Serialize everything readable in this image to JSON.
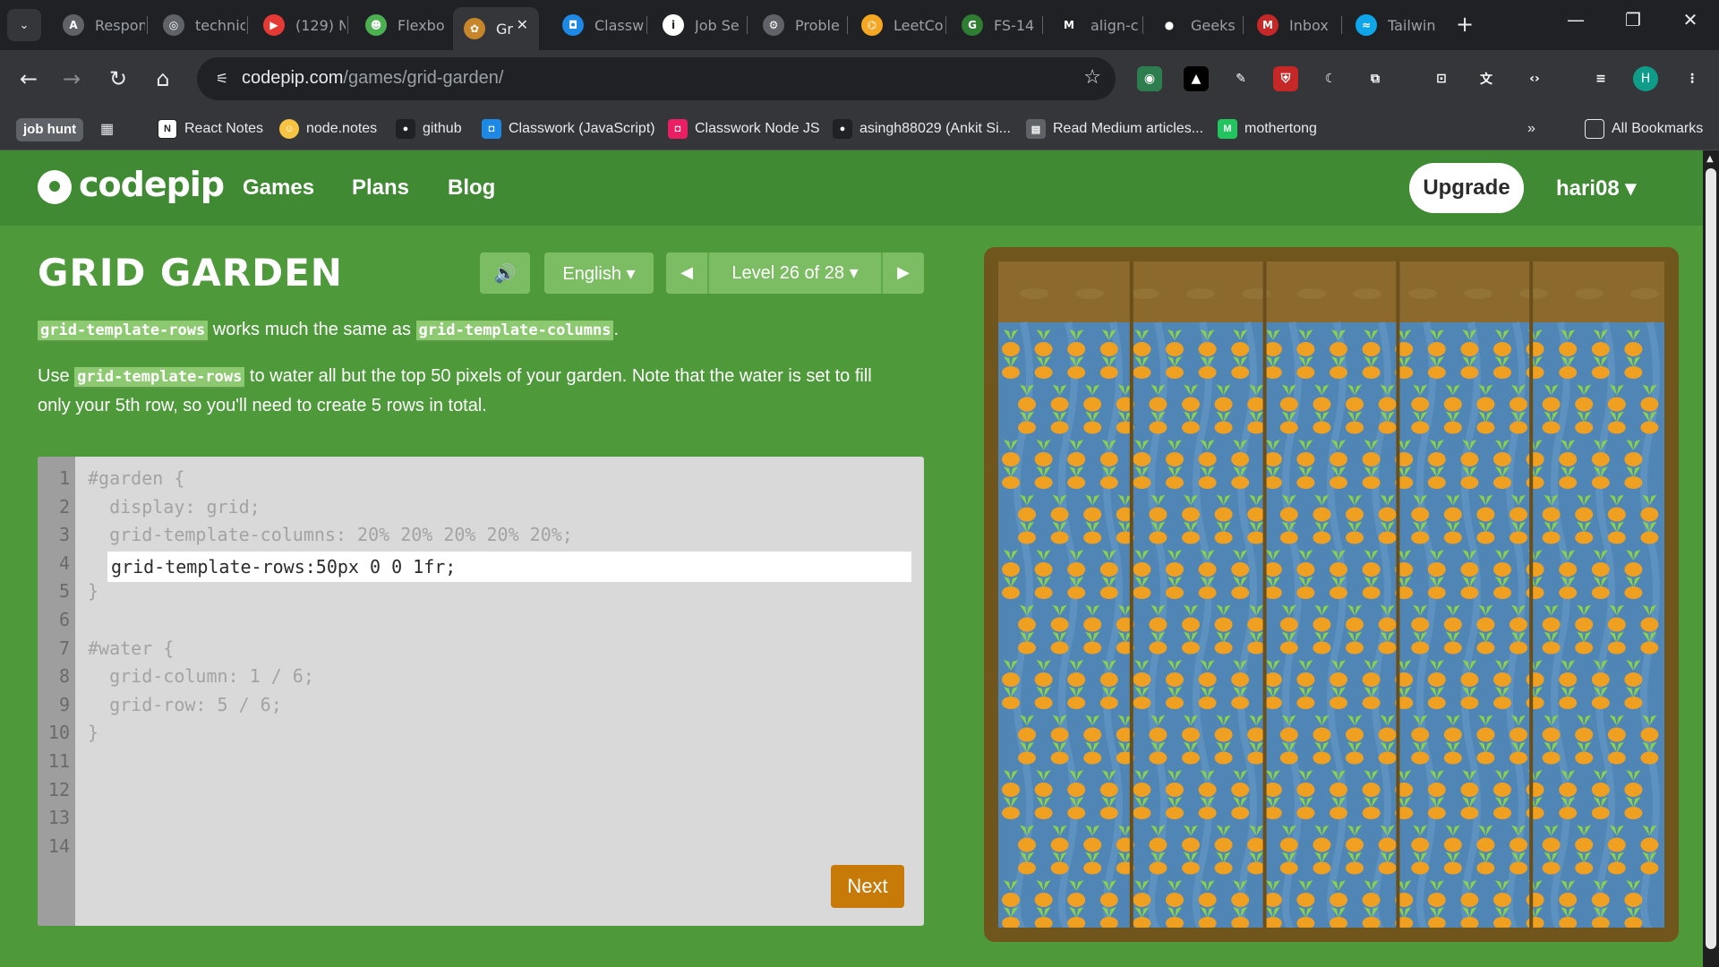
{
  "browser": {
    "tabs": [
      {
        "label": "Respon",
        "icon": "openai-icon",
        "color": "#5f6368",
        "glyph": "A"
      },
      {
        "label": "technic",
        "icon": "globe-icon",
        "color": "#5f6368",
        "glyph": "◎"
      },
      {
        "label": "(129) N",
        "icon": "youtube-icon",
        "color": "#e53935",
        "glyph": "▶"
      },
      {
        "label": "Flexbo",
        "icon": "frog-icon",
        "color": "#4caf50",
        "glyph": "☻"
      },
      {
        "label": "Gr",
        "icon": "carrot-icon",
        "color": "#c8862a",
        "glyph": "✿",
        "active": true
      },
      {
        "label": "Classw",
        "icon": "classroom-icon",
        "color": "#1e88e5",
        "glyph": "◘"
      },
      {
        "label": "Job Se",
        "icon": "info-icon",
        "color": "#ffffff",
        "glyph": "i"
      },
      {
        "label": "Proble",
        "icon": "gear-icon",
        "color": "#5f6368",
        "glyph": "⚙"
      },
      {
        "label": "LeetCo",
        "icon": "leetcode-icon",
        "color": "#f5a623",
        "glyph": "⌬"
      },
      {
        "label": "FS-14",
        "icon": "g-logo-icon",
        "color": "#2e7d32",
        "glyph": "G"
      },
      {
        "label": "align-c",
        "icon": "m-logo-icon",
        "color": "#202124",
        "glyph": "M"
      },
      {
        "label": "Geeks",
        "icon": "github-icon",
        "color": "#202124",
        "glyph": "●"
      },
      {
        "label": "Inbox",
        "icon": "gmail-icon",
        "color": "#c62828",
        "glyph": "M"
      },
      {
        "label": "Tailwin",
        "icon": "tailwind-icon",
        "color": "#0ea5e9",
        "glyph": "≈"
      }
    ],
    "url_domain": "codepip.com",
    "url_path": "/games/grid-garden/",
    "bookmarks": [
      {
        "label": "job hunt",
        "chip": true
      },
      {
        "label": "React Notes",
        "icon": "notion-icon",
        "color": "#ffffff",
        "glyph": "N"
      },
      {
        "label": "node.notes",
        "icon": "emoji-icon",
        "color": "#f6c343",
        "glyph": "☺"
      },
      {
        "label": "github",
        "icon": "github-icon",
        "color": "#202124",
        "glyph": "●"
      },
      {
        "label": "Classwork  (JavaScript)",
        "icon": "classroom-icon",
        "color": "#1e88e5",
        "glyph": "◘"
      },
      {
        "label": "Classwork  Node JS",
        "icon": "classroom-icon",
        "color": "#e91e63",
        "glyph": "◘"
      },
      {
        "label": "asingh88029 (Ankit Si...",
        "icon": "github-icon",
        "color": "#202124",
        "glyph": "●"
      },
      {
        "label": "Read Medium articles...",
        "icon": "medium-icon",
        "color": "#5f6368",
        "glyph": "▤"
      },
      {
        "label": "mothertong",
        "icon": "m-logo-icon",
        "color": "#22c55e",
        "glyph": "M"
      }
    ],
    "all_bookmarks": "All Bookmarks",
    "profile_initial": "H"
  },
  "site": {
    "logo": "codepip",
    "nav": [
      "Games",
      "Plans",
      "Blog"
    ],
    "upgrade": "Upgrade",
    "user": "hari08 ▾"
  },
  "game": {
    "title": "GRID GARDEN",
    "language": "English ▾",
    "level": "Level 26 of 28 ▾",
    "instructions": {
      "p1_code_a": "grid-template-rows",
      "p1_text": " works much the same as ",
      "p1_code_b": "grid-template-columns",
      "p1_end": ".",
      "p2_pre": "Use ",
      "p2_code": "grid-template-rows",
      "p2_text": " to water all but the top 50 pixels of your garden. Note that the water is set to fill",
      "p2_line2": "only your 5th row, so you'll need to create 5 rows in total."
    },
    "code_lines": [
      "#garden {",
      "  display: grid;",
      "  grid-template-columns: 20% 20% 20% 20% 20%;",
      "",
      "}",
      "",
      "#water {",
      "  grid-column: 1 / 6;",
      "  grid-row: 5 / 6;",
      "}",
      "",
      "",
      "",
      ""
    ],
    "input_value": "grid-template-rows:50px 0 0 1fr;",
    "next": "Next",
    "colors": {
      "soil": "#8c6a2e",
      "water": "#4f86b5",
      "frame": "#70561c",
      "carrot": "#f0a020",
      "leaf": "#8bd14a"
    }
  }
}
